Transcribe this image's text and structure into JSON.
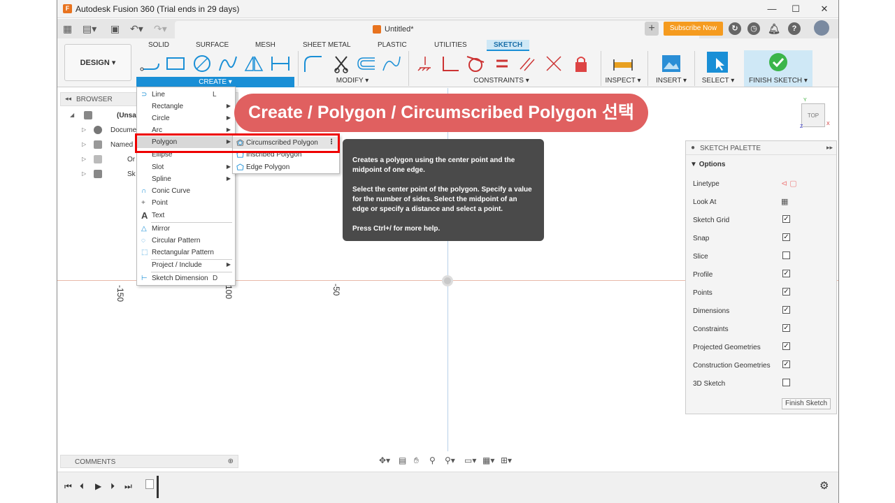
{
  "window": {
    "title": "Autodesk Fusion 360 (Trial ends in 29 days)",
    "app_icon": "F",
    "minimize": "—",
    "maximize": "☐",
    "close": "✕"
  },
  "document": {
    "tab_title": "Untitled*",
    "close": "✕",
    "new_tab": "+",
    "subscribe_label": "Subscribe Now"
  },
  "workspace": {
    "label": "DESIGN ▾"
  },
  "ribbon": {
    "tabs": [
      "SOLID",
      "SURFACE",
      "MESH",
      "SHEET METAL",
      "PLASTIC",
      "UTILITIES",
      "SKETCH"
    ],
    "active_tab": "SKETCH",
    "groups": {
      "create": "CREATE ▾",
      "modify": "MODIFY ▾",
      "constraints": "CONSTRAINTS ▾",
      "inspect": "INSPECT ▾",
      "insert": "INSERT ▾",
      "select": "SELECT ▾",
      "finish": "FINISH SKETCH ▾"
    }
  },
  "browser": {
    "label": "BROWSER",
    "items": [
      "(Unsa",
      "Docume",
      "Named",
      "Or",
      "Sk"
    ]
  },
  "create_menu": {
    "items": [
      {
        "label": "Line",
        "key": "L"
      },
      {
        "label": "Rectangle"
      },
      {
        "label": "Circle"
      },
      {
        "label": "Arc"
      },
      {
        "label": "Polygon"
      },
      {
        "label": "Ellipse"
      },
      {
        "label": "Slot"
      },
      {
        "label": "Spline"
      },
      {
        "label": "Conic Curve"
      },
      {
        "label": "Point"
      },
      {
        "label": "Text"
      },
      {
        "label": "Mirror"
      },
      {
        "label": "Circular Pattern"
      },
      {
        "label": "Rectangular Pattern"
      },
      {
        "label": "Project / Include"
      },
      {
        "label": "Sketch Dimension",
        "key": "D"
      }
    ]
  },
  "polygon_submenu": {
    "items": [
      "Circumscribed Polygon",
      "Inscribed Polygon",
      "Edge Polygon"
    ],
    "more": "⋮"
  },
  "tooltip": {
    "line1": "Creates a polygon using the center point and the midpoint of one edge.",
    "line2": "Select the center point of the polygon. Specify a value for the number of sides. Select the midpoint of an edge or specify a distance and select a point.",
    "line3": "Press Ctrl+/ for more help."
  },
  "banner": {
    "text": "Create / Polygon / Circumscribed Polygon 선택"
  },
  "canvas": {
    "ticks": [
      "-150",
      "100",
      "-50"
    ],
    "viewcube": "TOP",
    "axis_x": "X",
    "axis_y": "Y",
    "axis_z": "Z"
  },
  "palette": {
    "title": "SKETCH PALETTE",
    "section": "Options",
    "rows": [
      {
        "label": "Linetype",
        "kind": "icon"
      },
      {
        "label": "Look At",
        "kind": "icon"
      },
      {
        "label": "Sketch Grid",
        "checked": true
      },
      {
        "label": "Snap",
        "checked": true
      },
      {
        "label": "Slice",
        "checked": false
      },
      {
        "label": "Profile",
        "checked": true
      },
      {
        "label": "Points",
        "checked": true
      },
      {
        "label": "Dimensions",
        "checked": true
      },
      {
        "label": "Constraints",
        "checked": true
      },
      {
        "label": "Projected Geometries",
        "checked": true
      },
      {
        "label": "Construction Geometries",
        "checked": true
      },
      {
        "label": "3D Sketch",
        "checked": false
      }
    ],
    "finish_label": "Finish Sketch"
  },
  "comments": {
    "label": "COMMENTS"
  },
  "colors": {
    "accent_blue": "#1a8fd6",
    "banner_red": "#e06060",
    "highlight_red": "#e00000",
    "subscribe_orange": "#f59b1f"
  }
}
